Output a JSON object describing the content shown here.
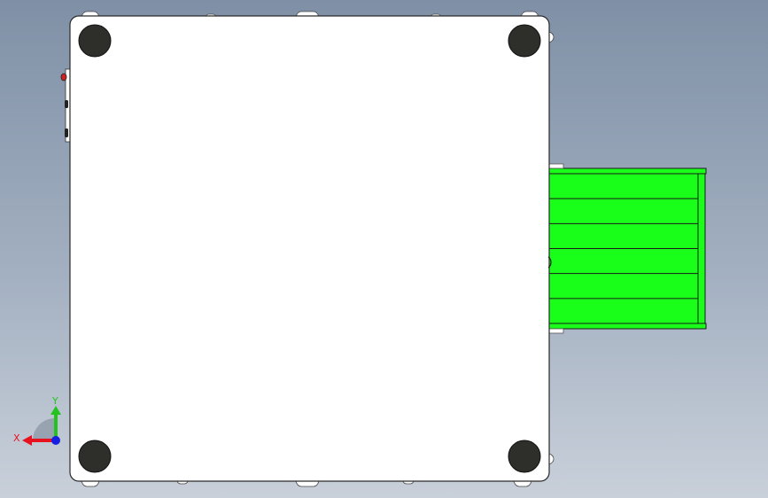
{
  "viewport": {
    "background_top": "#7f90a6",
    "background_bottom": "#c9d0da"
  },
  "model": {
    "panel_fill": "#ffffff",
    "outline": "#2a2a2a",
    "foot_fill": "#2e2f2b",
    "tray_fill": "#19ff19",
    "tray_slats": 6
  },
  "triad": {
    "x_label": "X",
    "y_label": "Y",
    "x_color": "#e8121f",
    "y_color": "#22c21f",
    "z_color": "#1520e0"
  }
}
